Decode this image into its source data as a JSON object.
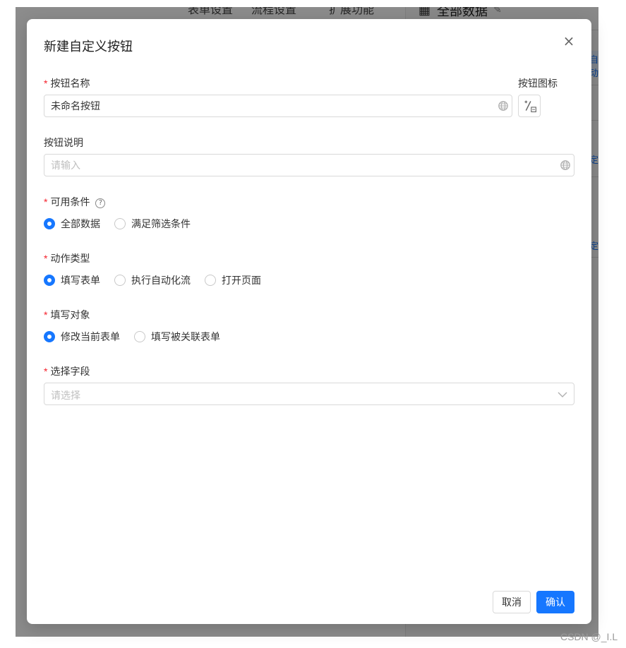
{
  "background": {
    "panel_title": "全部数据",
    "side_text_1": "自动",
    "side_text_2": "定",
    "side_text_3": "定",
    "top_text_1": "表单设置",
    "top_text_2": "流程设置",
    "top_text_3": "扩展功能"
  },
  "modal": {
    "title": "新建自定义按钮",
    "close_glyph": "×",
    "button_name": {
      "label": "按钮名称",
      "required_mark": "*",
      "value": "未命名按钮"
    },
    "button_icon": {
      "label": "按钮图标"
    },
    "button_desc": {
      "label": "按钮说明",
      "placeholder": "请输入"
    },
    "condition": {
      "label": "可用条件",
      "required_mark": "*",
      "help_glyph": "?",
      "options": [
        "全部数据",
        "满足筛选条件"
      ],
      "selected": "全部数据"
    },
    "action_type": {
      "label": "动作类型",
      "required_mark": "*",
      "options": [
        "填写表单",
        "执行自动化流",
        "打开页面"
      ],
      "selected": "填写表单"
    },
    "fill_target": {
      "label": "填写对象",
      "required_mark": "*",
      "options": [
        "修改当前表单",
        "填写被关联表单"
      ],
      "selected": "修改当前表单"
    },
    "select_field": {
      "label": "选择字段",
      "required_mark": "*",
      "placeholder": "请选择"
    },
    "footer": {
      "cancel_label": "取消",
      "ok_label": "确认"
    }
  },
  "watermark": "CSDN @_I.L",
  "colors": {
    "primary": "#1677ff",
    "required": "#f5222d",
    "overlay": "rgba(0,0,0,0.45)"
  }
}
